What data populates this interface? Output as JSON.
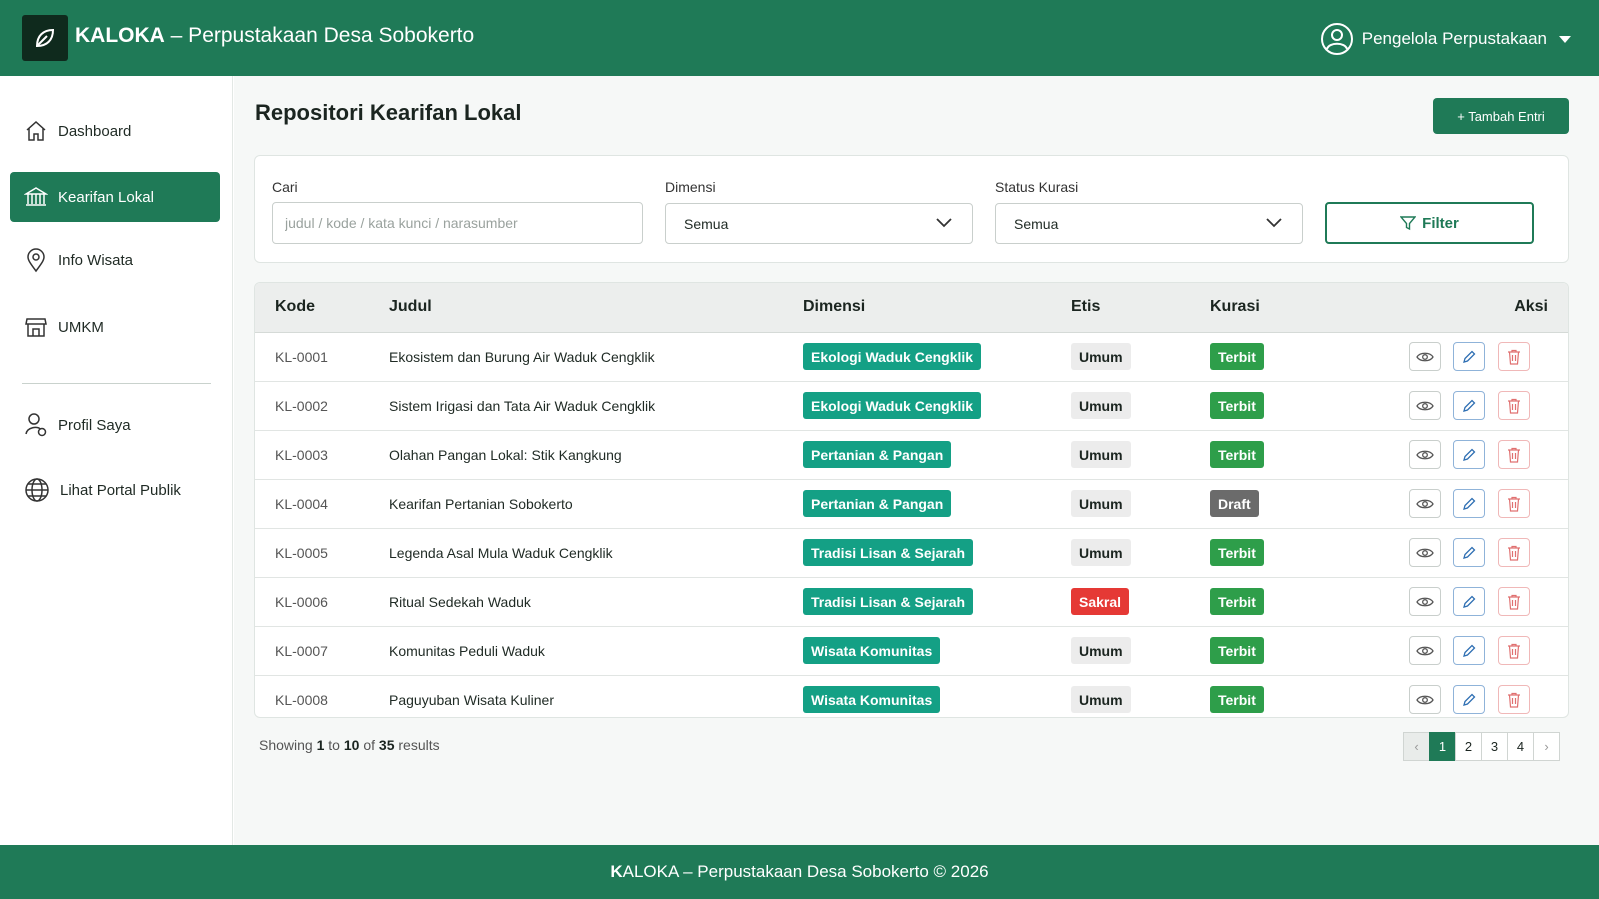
{
  "header": {
    "brand_name": "KALOKA",
    "brand_sub": "– Perpustakaan Desa Sobokerto",
    "user_label": "Pengelola Perpustakaan"
  },
  "sidebar": {
    "items": [
      {
        "label": "Dashboard",
        "icon": "home-icon"
      },
      {
        "label": "Kearifan Lokal",
        "icon": "museum-icon"
      },
      {
        "label": "Info Wisata",
        "icon": "map-pin-icon"
      },
      {
        "label": "UMKM",
        "icon": "store-icon"
      },
      {
        "label": "Profil Saya",
        "icon": "user-settings-icon"
      },
      {
        "label": "Lihat Portal Publik",
        "icon": "globe-icon"
      }
    ]
  },
  "main": {
    "title": "Repositori Kearifan Lokal",
    "add_button": "+ Tambah Entri"
  },
  "filters": {
    "search_label": "Cari",
    "search_placeholder": "judul / kode / kata kunci / narasumber",
    "dimensi_label": "Dimensi",
    "dimensi_value": "Semua",
    "status_label": "Status Kurasi",
    "status_value": "Semua",
    "filter_button": "Filter"
  },
  "table": {
    "headers": {
      "kode": "Kode",
      "judul": "Judul",
      "dimensi": "Dimensi",
      "etis": "Etis",
      "kurasi": "Kurasi",
      "aksi": "Aksi"
    },
    "rows": [
      {
        "kode": "KL-0001",
        "judul": "Ekosistem dan Burung Air Waduk Cengklik",
        "dimensi": "Ekologi Waduk Cengklik",
        "etis": "Umum",
        "kurasi": "Terbit"
      },
      {
        "kode": "KL-0002",
        "judul": "Sistem Irigasi dan Tata Air Waduk Cengklik",
        "dimensi": "Ekologi Waduk Cengklik",
        "etis": "Umum",
        "kurasi": "Terbit"
      },
      {
        "kode": "KL-0003",
        "judul": "Olahan Pangan Lokal: Stik Kangkung",
        "dimensi": "Pertanian & Pangan",
        "etis": "Umum",
        "kurasi": "Terbit"
      },
      {
        "kode": "KL-0004",
        "judul": "Kearifan Pertanian Sobokerto",
        "dimensi": "Pertanian & Pangan",
        "etis": "Umum",
        "kurasi": "Draft"
      },
      {
        "kode": "KL-0005",
        "judul": "Legenda Asal Mula Waduk Cengklik",
        "dimensi": "Tradisi Lisan & Sejarah",
        "etis": "Umum",
        "kurasi": "Terbit"
      },
      {
        "kode": "KL-0006",
        "judul": "Ritual Sedekah Waduk",
        "dimensi": "Tradisi Lisan & Sejarah",
        "etis": "Sakral",
        "kurasi": "Terbit"
      },
      {
        "kode": "KL-0007",
        "judul": "Komunitas Peduli Waduk",
        "dimensi": "Wisata Komunitas",
        "etis": "Umum",
        "kurasi": "Terbit"
      },
      {
        "kode": "KL-0008",
        "judul": "Paguyuban Wisata Kuliner",
        "dimensi": "Wisata Komunitas",
        "etis": "Umum",
        "kurasi": "Terbit"
      }
    ]
  },
  "pagination": {
    "showing_prefix": "Showing",
    "from": "1",
    "to_word": "to",
    "to": "10",
    "of_word": "of",
    "total": "35",
    "suffix": "results",
    "pages": [
      "1",
      "2",
      "3",
      "4"
    ],
    "prev": "‹",
    "next": "›"
  },
  "footer": {
    "brand_initial": "K",
    "text": "ALOKA – Perpustakaan Desa Sobokerto © 2026"
  },
  "colors": {
    "primary": "#1f7a57",
    "dimensi_badge": "#14a085",
    "terbit": "#2e9e4a",
    "sakral": "#e53935",
    "draft": "#6b6b6b"
  }
}
